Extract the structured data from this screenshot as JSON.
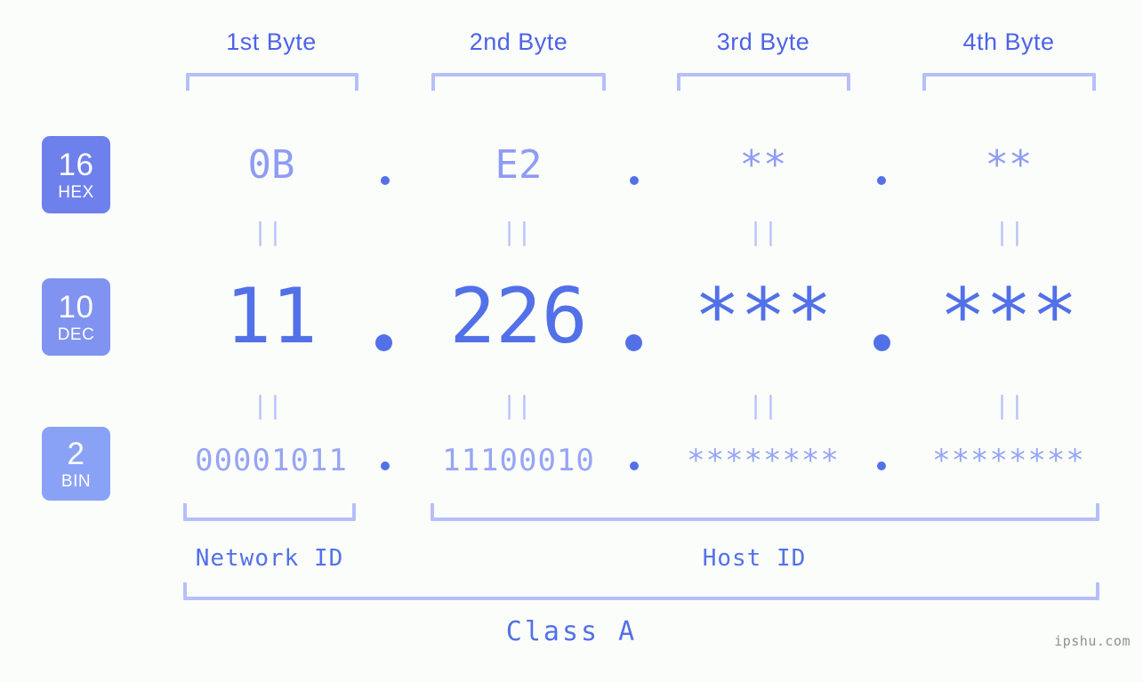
{
  "page": {
    "background_color": "#fbfdfa",
    "accent_color": "#5271e8",
    "light_accent_color": "#b6bffa"
  },
  "byte_headers": [
    {
      "label": "1st Byte"
    },
    {
      "label": "2nd Byte"
    },
    {
      "label": "3rd Byte"
    },
    {
      "label": "4th Byte"
    }
  ],
  "bases": [
    {
      "number": "16",
      "name": "HEX",
      "color": "#6e80ec"
    },
    {
      "number": "10",
      "name": "DEC",
      "color": "#8093f0"
    },
    {
      "number": "2",
      "name": "BIN",
      "color": "#8aa2f6"
    }
  ],
  "rows": {
    "hex": {
      "values": [
        "0B",
        "E2",
        "**",
        "**"
      ]
    },
    "dec": {
      "values": [
        "11",
        "226",
        "***",
        "***"
      ]
    },
    "bin": {
      "values": [
        "00001011",
        "11100010",
        "********",
        "********"
      ]
    }
  },
  "separators": {
    "symbol": "."
  },
  "equality": {
    "symbol": "||"
  },
  "id_labels": {
    "network": "Network ID",
    "host": "Host ID"
  },
  "class_label": "Class A",
  "watermark": "ipshu.com"
}
